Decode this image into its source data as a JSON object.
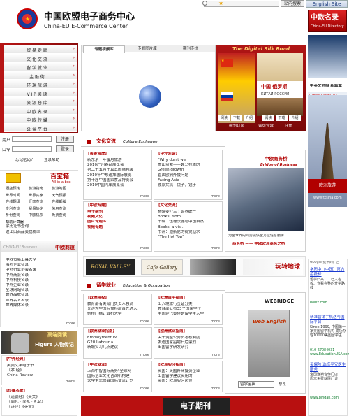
{
  "site": {
    "name_cn": "中国欧盟电子商务中心",
    "name_en": "China-EU E-Commerce Center",
    "search_button": "站内搜索",
    "english_site": "English Site"
  },
  "nav": [
    "贸 易 走 廊",
    "文 化 交 流",
    "留 学 就 业",
    "金 融 街",
    "环 球 旅 游",
    "V I P 阅 读",
    "资 源 仓 库",
    "中 欧 名 录",
    "中 欧 传 媒",
    "公 益 平 台"
  ],
  "login": {
    "user_label": "用户",
    "password_label": "口令",
    "register": "注册",
    "login": "登录",
    "forgot": "忘记密码？",
    "help": "登录帮助"
  },
  "baibaoxiang": {
    "title": "百宝箱",
    "subtitle": "All in a box",
    "items": [
      "酒店预定",
      "旅游指南",
      "旅游地图",
      "世界时间",
      "世界买家",
      "天气预报",
      "在线翻译",
      "汇率查询",
      "在线邮编",
      "专利查询",
      "贸易协定",
      "信用查询",
      "身份查询",
      "中欧机票",
      "免费查询",
      "帮助计算器"
    ],
    "extra": [
      "学历证书查询",
      "进出口商品关税税率"
    ]
  },
  "eu_business": {
    "title": "中欧商道",
    "subtitle": "CHINA-EU Business",
    "items": [
      "中欧贸易工具大全",
      "海外企业名录",
      "中外行业协会名录",
      "中外商会名录",
      "中外科技名录",
      "中外企业名录",
      "全球网站名录",
      "世界品牌名录",
      "世界名人名录",
      "世界媒体名录"
    ],
    "more": "more"
  },
  "people": {
    "title": "高端阅读",
    "subtitle": "Figure 人物传记"
  },
  "economics": {
    "title": "【中外经典】",
    "items": [
      "英美文学电子书",
      "《孝 经》",
      "China Review"
    ],
    "more": "more"
  },
  "collection": {
    "title": "【珍藏名录】",
    "items": [
      "《道德经》《英文》",
      "《周礼・仪礼・礼记》",
      "《诗经》《英文》"
    ]
  },
  "tabs": [
    "专题视频库",
    "专题图片库",
    "期刊专栏"
  ],
  "silk": {
    "title": "The Digital Silk Road",
    "book_cn": "中国 俄罗斯",
    "book_ru": "КИТАЙ-РОССИЯ",
    "links": [
      "阅读",
      "下载",
      "介绍"
    ],
    "bottom": [
      "期刊订阅",
      "会员登录",
      "注册"
    ]
  },
  "culture": {
    "title": "文化交流",
    "title_en": "Culture Exchange",
    "col1_title": "【黄金海岸】",
    "col1": [
      "新东京十年蜜月旅游",
      "2010广州春品展览会",
      "第二十五届土耳其国际包装",
      "2010年中东迪拜国际展览",
      "第十届中国国家食品博览会",
      "2010中国汽车展览会"
    ],
    "col2_title": "【中外对话】",
    "col2": [
      "\"Why don't we",
      "雪山蓝紫——聂马拉雅的",
      "Green growth",
      "直面欧洲外援问题",
      "Facing Asia",
      "独家文稿：镜子，镜子"
    ],
    "col3_title": "【中欧专题】",
    "col3": [
      "电子期刊",
      "视频文化",
      "图片专题库",
      "视频专题"
    ],
    "col4_title": "【文化交流】",
    "col4": [
      "杨晓雯介兰 : 世界统一",
      "Books: from ...",
      "书评：伍德沃德与中国自然",
      "Books: a vis...",
      "书评：迪斯尼的视觉追求",
      "\"The Hot Top\""
    ],
    "bridge_title": "中欧商务桥",
    "bridge_sub": "Bridge of Business",
    "bridge_caption": "为全世界的商务提供全方位信息服务",
    "bridge_link": "商务桥 —— 中欧欧洲商务之桥",
    "more": "more"
  },
  "study": {
    "title": "留学就业",
    "title_en": "Education & Occupation",
    "col1_title": "【欧洲院校】",
    "col1": [
      "教育部有关部门负责人强调",
      "允许大学国际预科后首先进入",
      "剑桥门槛计算机大学"
    ],
    "col2_title": "【欧洲留学指南】",
    "col2": [
      "出入境旅行签证分类",
      "教育部公布33个国家学位",
      "中国驻巴黎使馆留学生入学"
    ],
    "col3_title": "【欧洲就业指南】",
    "col3": [
      "Employment W",
      "G20 Labour a",
      "新城实习几点建议"
    ],
    "col4_title": "【欧洲就业指南】",
    "col4": [
      "关于调整公务员考核制度",
      "发达国家招聘日趋激烈",
      "出国留学研发研究"
    ],
    "col5_title": "【中欧就业】",
    "col5": [
      "上海中智国际商务\"全球网",
      "国际企业文化咨询机构建",
      "大学生志愿者国际交流计划"
    ],
    "col6_title": "【欧洲实习指南】",
    "col6": [
      "英国：英国外商投资企业",
      "出国留学建议实用的",
      "英国：欧洲实习岗位"
    ],
    "book_title": "WEBRIDGE",
    "book_sub": "Web English",
    "book_select": "留学宝典",
    "book_label": "总览",
    "more": "more"
  },
  "banner_text": "电子期刊",
  "right_ads": {
    "brand_title": "中欧名录",
    "brand_sub": "China-EU Directory",
    "banner1": "中英文对照  新篇章",
    "banner2": "中英文对照 拓宽视野",
    "ad1": "中欧电子商务中心",
    "site_url": "www.fxsina.com"
  },
  "google_ads": {
    "label": "Google 提供的广告",
    "items": [
      {
        "title": "学历中（中国）官方招投标",
        "desc": "留学归来……已入名校、查看完整的升学路线",
        "url": "Rolex.com"
      },
      {
        "title": "精准营销手机达与国际平台",
        "desc": "Since 1999, 中国第一家美国留学机构 成功办理10000美国留学生",
        "url": "010-67084031 www.EducationUSA.com"
      },
      {
        "title": "买保险 选择平安医生服务",
        "desc": "全国连锁合作门店……周末免费就医门诊",
        "url": "www.pingan.com"
      }
    ]
  }
}
